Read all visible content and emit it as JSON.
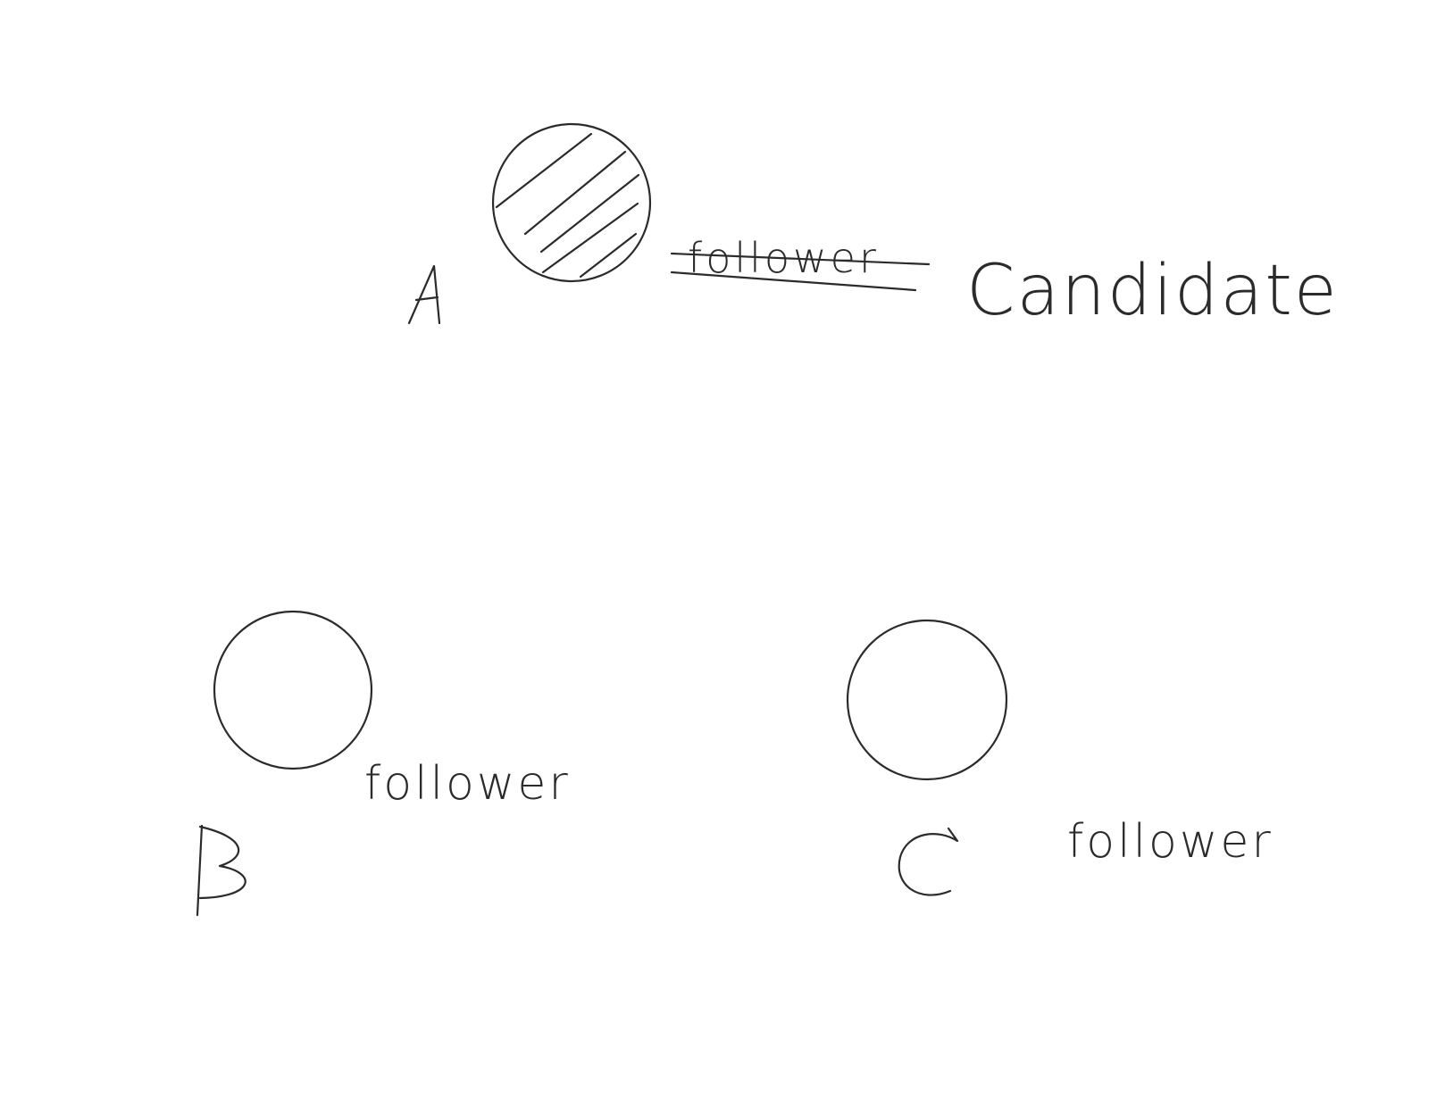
{
  "nodes": [
    {
      "id": "A",
      "letter": "A",
      "state_label": "Candidate",
      "previous_label": "follower",
      "previous_label_struck": true,
      "shaded": true
    },
    {
      "id": "B",
      "letter": "B",
      "state_label": "follower",
      "shaded": false
    },
    {
      "id": "C",
      "letter": "C",
      "state_label": "follower",
      "shaded": false
    }
  ],
  "colors": {
    "ink": "#2b2b2b",
    "background": "#ffffff"
  }
}
